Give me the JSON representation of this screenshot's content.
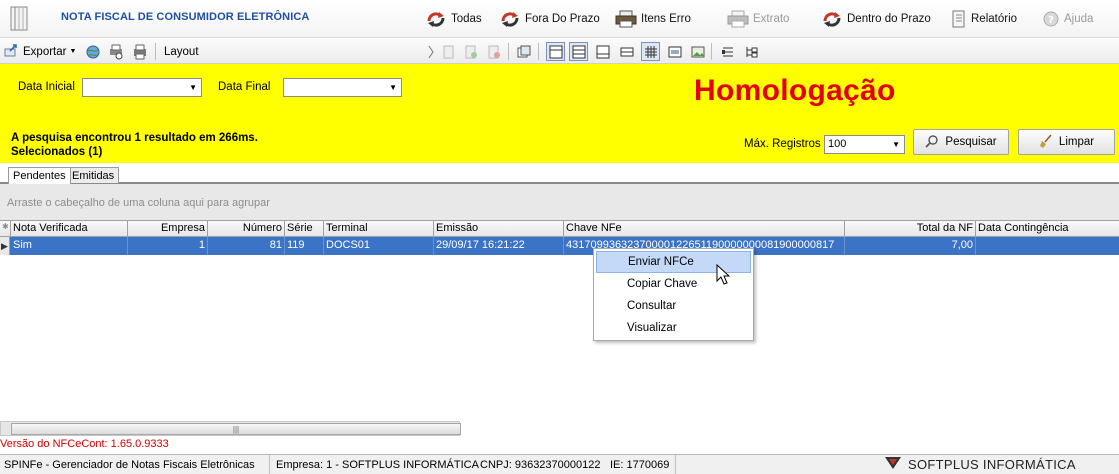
{
  "header": {
    "title": "NOTA FISCAL DE CONSUMIDOR ELETRÔNICA",
    "buttons": [
      {
        "label": "Todas",
        "icon": "refresh-arrows-icon"
      },
      {
        "label": "Fora Do Prazo",
        "icon": "refresh-arrows-icon"
      },
      {
        "label": "Itens Erro",
        "icon": "printer-icon"
      },
      {
        "label": "Extrato",
        "icon": "printer-icon"
      },
      {
        "label": "Dentro do Prazo",
        "icon": "refresh-arrows-icon"
      },
      {
        "label": "Relatório",
        "icon": "report-icon"
      },
      {
        "label": "Ajuda",
        "icon": "help-icon"
      }
    ]
  },
  "toolbar": {
    "export_label": "Exportar",
    "layout_label": "Layout"
  },
  "filters": {
    "start_date_label": "Data Inicial",
    "start_date_value": "",
    "end_date_label": "Data Final",
    "end_date_value": "",
    "environment": "Homologação",
    "result_text": "A pesquisa encontrou 1 resultado em 266ms.",
    "selected_text": "Selecionados (1)",
    "max_records_label": "Máx. Registros",
    "max_records_value": "100",
    "search_label": "Pesquisar",
    "clear_label": "Limpar"
  },
  "tabs": [
    "Pendentes",
    "Emitidas"
  ],
  "grid": {
    "group_hint": "Arraste o cabeçalho de uma coluna aqui para agrupar",
    "columns": [
      "Nota Verificada",
      "Empresa",
      "Número",
      "Série",
      "Terminal",
      "Emissão",
      "Chave NFe",
      "Total da NF",
      "Data Contingência"
    ],
    "rows": [
      [
        "Sim",
        "1",
        "81",
        "119",
        "DOCS01",
        "29/09/17 16:21:22",
        "43170993632370000122651190000000081900000817",
        "7,00",
        ""
      ]
    ]
  },
  "context_menu": {
    "items": [
      "Enviar NFCe",
      "Copiar Chave",
      "Consultar",
      "Visualizar"
    ],
    "highlighted": "Enviar NFCe"
  },
  "version_text": "Versão do NFCeCont: 1.65.0.9333",
  "status_bar": {
    "app": "SPINFe - Gerenciador de Notas Fiscais Eletrônicas",
    "company": "Empresa: 1 - SOFTPLUS INFORMÁTICA",
    "cnpj": "CNPJ: 93632370000122",
    "ie": "IE: 1770069",
    "brand": "SOFTPLUS INFORMÁTICA"
  },
  "colors": {
    "panel": "#ffff00",
    "environment": "#e3000f",
    "selection": "#3b73c7",
    "title": "#1f4f9e"
  }
}
